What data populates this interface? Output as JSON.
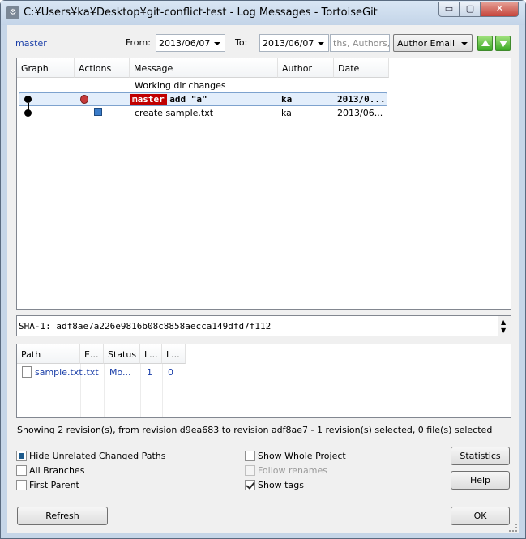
{
  "window": {
    "title": "C:¥Users¥ka¥Desktop¥git-conflict-test - Log Messages - TortoiseGit",
    "min_symbol": "▭",
    "max_symbol": "▢",
    "close_symbol": "✕"
  },
  "filters": {
    "branch_link": "master",
    "from_label": "From:",
    "from_value": "2013/06/07",
    "to_label": "To:",
    "to_value": "2013/06/07",
    "search_placeholder": "ths, Authors, E",
    "filter_field": "Author Email"
  },
  "log": {
    "columns": [
      "Graph",
      "Actions",
      "Message",
      "Author",
      "Date"
    ],
    "rows": [
      {
        "message": "Working dir changes",
        "author": "",
        "date": ""
      },
      {
        "tag": "master",
        "message": "add \"a\"",
        "author": "ka",
        "date": "2013/0..."
      },
      {
        "message": "create sample.txt",
        "author": "ka",
        "date": "2013/06..."
      }
    ]
  },
  "detail": {
    "text": "SHA-1: adf8ae7a226e9816b08c8858aecca149dfd7f112"
  },
  "files": {
    "columns": [
      "Path",
      "E...",
      "Status",
      "L...",
      "L..."
    ],
    "rows": [
      {
        "path": "sample.txt",
        "ext": ".txt",
        "status": "Mo...",
        "l1": "1",
        "l2": "0"
      }
    ]
  },
  "status_text": "Showing 2 revision(s), from revision d9ea683 to revision adf8ae7 - 1 revision(s) selected, 0 file(s) selected",
  "options": {
    "hide_unrelated": "Hide Unrelated Changed Paths",
    "all_branches": "All Branches",
    "first_parent": "First Parent",
    "show_whole_project": "Show Whole Project",
    "follow_renames": "Follow renames",
    "show_tags": "Show tags"
  },
  "buttons": {
    "statistics": "Statistics",
    "help": "Help",
    "refresh": "Refresh",
    "ok": "OK"
  }
}
